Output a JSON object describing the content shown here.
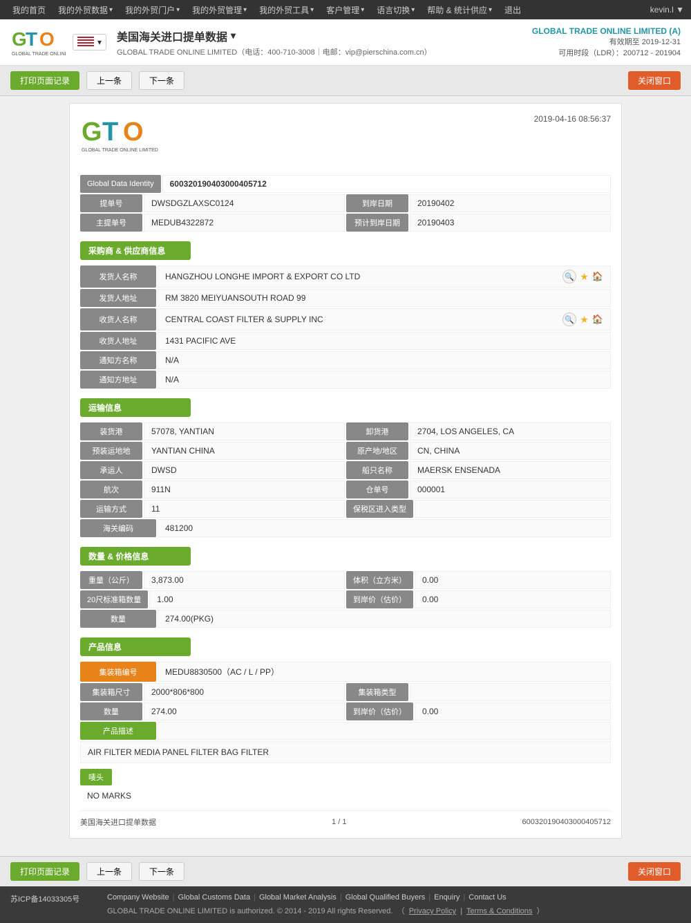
{
  "topnav": {
    "items": [
      {
        "label": "我的首页",
        "id": "home"
      },
      {
        "label": "我的外贸数据",
        "id": "trade-data"
      },
      {
        "label": "我的外贸门户",
        "id": "portal"
      },
      {
        "label": "我的外贸管理",
        "id": "management"
      },
      {
        "label": "我的外贸工具",
        "id": "tools"
      },
      {
        "label": "客户管理",
        "id": "customer"
      },
      {
        "label": "语言切换",
        "id": "language"
      },
      {
        "label": "帮助 & 统计供应",
        "id": "help"
      },
      {
        "label": "退出",
        "id": "logout"
      }
    ],
    "user": "kevin.l ▼"
  },
  "header": {
    "page_title": "美国海关进口提单数据",
    "subtitle": "GLOBAL TRADE ONLINE LIMITED（电话：400-710-3008｜电邮：vip@pierschina.com.cn）",
    "company_name": "GLOBAL TRADE ONLINE LIMITED (A)",
    "validity": "有效期至 2019-12-31",
    "ldr": "可用时段（LDR）：200712 - 201904"
  },
  "toolbar": {
    "print_label": "打印页面记录",
    "prev_label": "上一条",
    "next_label": "下一条",
    "close_label": "关闭窗口"
  },
  "doc": {
    "datetime": "2019-04-16 08:56:37",
    "global_data_identity_label": "Global Data Identity",
    "global_data_identity_value": "600320190403000405712",
    "bill_no_label": "提单号",
    "bill_no_value": "DWSDGZLAXSC0124",
    "arrival_date_label": "到岸日期",
    "arrival_date_value": "20190402",
    "master_bill_label": "主提单号",
    "master_bill_value": "MEDUB4322872",
    "estimated_date_label": "预计到岸日期",
    "estimated_date_value": "20190403",
    "section_buyer": "采购商 & 供应商信息",
    "shipper_name_label": "发货人名称",
    "shipper_name_value": "HANGZHOU LONGHE IMPORT & EXPORT CO LTD",
    "shipper_addr_label": "发货人地址",
    "shipper_addr_value": "RM 3820 MEIYUANSOUTH ROAD 99",
    "consignee_name_label": "收货人名称",
    "consignee_name_value": "CENTRAL COAST FILTER & SUPPLY INC",
    "consignee_addr_label": "收货人地址",
    "consignee_addr_value": "1431 PACIFIC AVE",
    "notify_name_label": "通知方名称",
    "notify_name_value": "N/A",
    "notify_addr_label": "通知方地址",
    "notify_addr_value": "N/A",
    "section_transport": "运输信息",
    "load_port_label": "装货港",
    "load_port_value": "57078, YANTIAN",
    "dest_port_label": "卸货港",
    "dest_port_value": "2704, LOS ANGELES, CA",
    "preload_place_label": "预装运地地",
    "preload_place_value": "YANTIAN CHINA",
    "origin_label": "原产地/地区",
    "origin_value": "CN, CHINA",
    "carrier_label": "承运人",
    "carrier_value": "DWSD",
    "vessel_name_label": "船只名称",
    "vessel_name_value": "MAERSK ENSENADA",
    "voyage_label": "航次",
    "voyage_value": "911N",
    "manifest_label": "仓单号",
    "manifest_value": "000001",
    "transport_mode_label": "运输方式",
    "transport_mode_value": "11",
    "bonded_zone_label": "保税区进入类型",
    "bonded_zone_value": "",
    "sea_bill_label": "海关编码",
    "sea_bill_value": "481200",
    "section_quantity": "数量 & 价格信息",
    "weight_label": "重量（公斤）",
    "weight_value": "3,873.00",
    "volume_label": "体积（立方米）",
    "volume_value": "0.00",
    "container20_label": "20尺标准箱数量",
    "container20_value": "1.00",
    "unit_price_label": "到岸价（估价）",
    "unit_price_value": "0.00",
    "quantity_label": "数量",
    "quantity_value": "274.00(PKG)",
    "section_product": "产品信息",
    "container_no_label": "集装箱编号",
    "container_no_value": "MEDU8830500（AC / L / PP）",
    "container_size_label": "集装箱尺寸",
    "container_size_value": "2000*806*800",
    "container_type_label": "集装箱类型",
    "container_type_value": "",
    "product_qty_label": "数量",
    "product_qty_value": "274.00",
    "product_price_label": "到岸价（估价）",
    "product_price_value": "0.00",
    "product_desc_label": "产品描述",
    "product_desc_value": "AIR FILTER MEDIA PANEL FILTER BAG FILTER",
    "marks_label": "唛头",
    "marks_value": "NO MARKS",
    "footer_left": "美国海关进口提单数据",
    "footer_center": "1 / 1",
    "footer_right": "600320190403000405712"
  },
  "site_footer": {
    "icp": "苏ICP备14033305号",
    "links": [
      {
        "label": "Company Website"
      },
      {
        "label": "Global Customs Data"
      },
      {
        "label": "Global Market Analysis"
      },
      {
        "label": "Global Qualified Buyers"
      },
      {
        "label": "Enquiry"
      },
      {
        "label": "Contact Us"
      }
    ],
    "copyright": "GLOBAL TRADE ONLINE LIMITED is authorized. © 2014 - 2019 All rights Reserved.",
    "privacy": "Privacy Policy",
    "terms": "Terms & Conditions"
  }
}
